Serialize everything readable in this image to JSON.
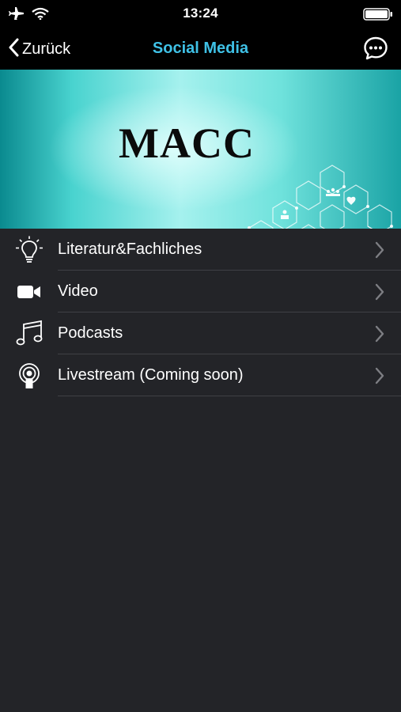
{
  "status": {
    "time": "13:24"
  },
  "nav": {
    "back_label": "Zurück",
    "title": "Social Media"
  },
  "banner": {
    "title": "MACC"
  },
  "menu": {
    "items": [
      {
        "label": "Literatur&Fachliches",
        "icon": "lightbulb-icon"
      },
      {
        "label": "Video",
        "icon": "video-camera-icon"
      },
      {
        "label": "Podcasts",
        "icon": "music-note-icon"
      },
      {
        "label": "Livestream (Coming soon)",
        "icon": "broadcast-icon"
      }
    ]
  },
  "colors": {
    "accent": "#3fc1e6",
    "background": "#232428",
    "bar": "#000000"
  }
}
